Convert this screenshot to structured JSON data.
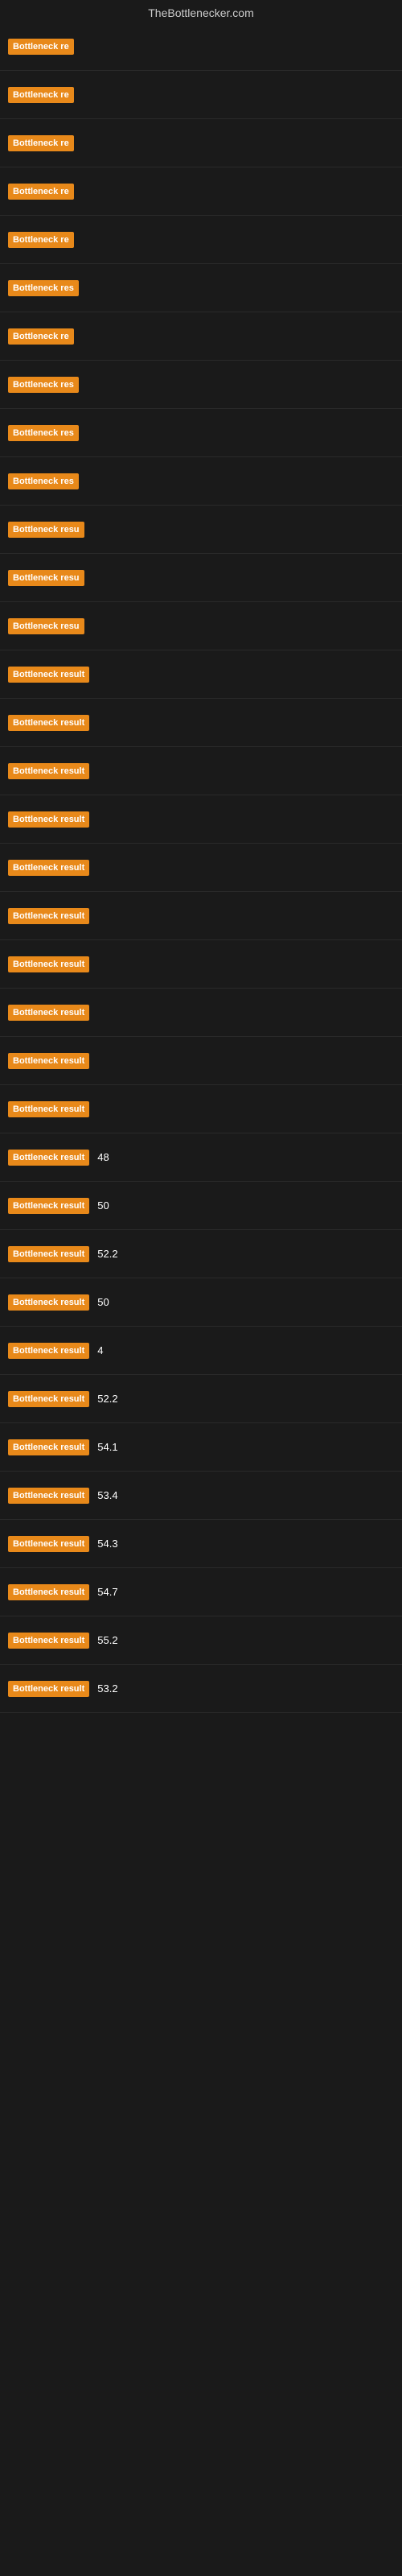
{
  "site_title": "TheBottlenecker.com",
  "rows": [
    {
      "label": "Bottleneck re",
      "value": ""
    },
    {
      "label": "Bottleneck re",
      "value": ""
    },
    {
      "label": "Bottleneck re",
      "value": ""
    },
    {
      "label": "Bottleneck re",
      "value": ""
    },
    {
      "label": "Bottleneck re",
      "value": ""
    },
    {
      "label": "Bottleneck res",
      "value": ""
    },
    {
      "label": "Bottleneck re",
      "value": ""
    },
    {
      "label": "Bottleneck res",
      "value": ""
    },
    {
      "label": "Bottleneck res",
      "value": ""
    },
    {
      "label": "Bottleneck res",
      "value": ""
    },
    {
      "label": "Bottleneck resu",
      "value": ""
    },
    {
      "label": "Bottleneck resu",
      "value": ""
    },
    {
      "label": "Bottleneck resu",
      "value": ""
    },
    {
      "label": "Bottleneck result",
      "value": ""
    },
    {
      "label": "Bottleneck result",
      "value": ""
    },
    {
      "label": "Bottleneck result",
      "value": ""
    },
    {
      "label": "Bottleneck result",
      "value": ""
    },
    {
      "label": "Bottleneck result",
      "value": ""
    },
    {
      "label": "Bottleneck result",
      "value": ""
    },
    {
      "label": "Bottleneck result",
      "value": ""
    },
    {
      "label": "Bottleneck result",
      "value": ""
    },
    {
      "label": "Bottleneck result",
      "value": ""
    },
    {
      "label": "Bottleneck result",
      "value": ""
    },
    {
      "label": "Bottleneck result",
      "value": "48"
    },
    {
      "label": "Bottleneck result",
      "value": "50"
    },
    {
      "label": "Bottleneck result",
      "value": "52.2"
    },
    {
      "label": "Bottleneck result",
      "value": "50"
    },
    {
      "label": "Bottleneck result",
      "value": "4"
    },
    {
      "label": "Bottleneck result",
      "value": "52.2"
    },
    {
      "label": "Bottleneck result",
      "value": "54.1"
    },
    {
      "label": "Bottleneck result",
      "value": "53.4"
    },
    {
      "label": "Bottleneck result",
      "value": "54.3"
    },
    {
      "label": "Bottleneck result",
      "value": "54.7"
    },
    {
      "label": "Bottleneck result",
      "value": "55.2"
    },
    {
      "label": "Bottleneck result",
      "value": "53.2"
    }
  ]
}
